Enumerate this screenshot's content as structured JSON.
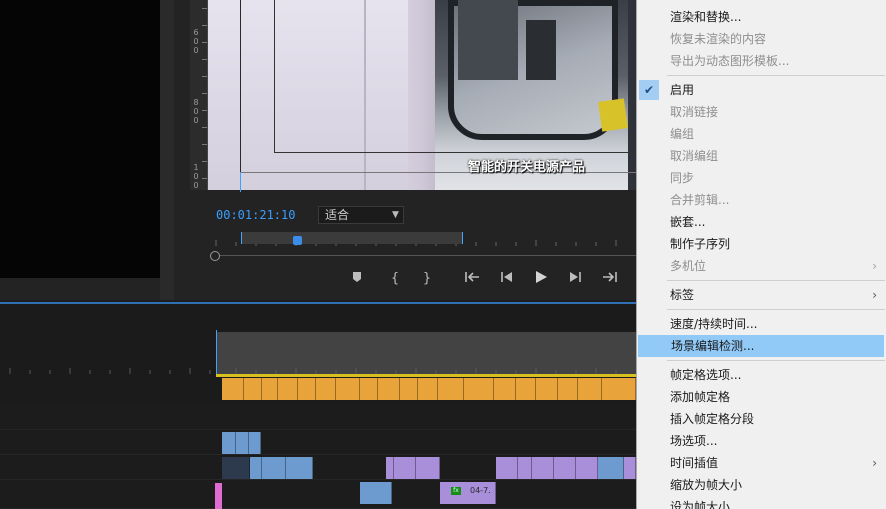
{
  "program_monitor": {
    "timecode": "00:01:21:10",
    "fit_label": "适合",
    "caption": "智能的开关电源产品",
    "ruler_labels": [
      "6",
      "0",
      "0",
      "8",
      "0",
      "0",
      "1",
      "0",
      "0",
      "0"
    ]
  },
  "transport": {
    "marker": "marker-icon",
    "mark_in": "mark-in-icon",
    "mark_out": "mark-out-icon",
    "go_to_in": "go-to-in-icon",
    "step_back": "step-back-icon",
    "play": "play-icon",
    "step_forward": "step-forward-icon",
    "go_to_out": "go-to-out-icon"
  },
  "timeline": {
    "clip_label": "04-7.",
    "fx_badge": "fx"
  },
  "colors": {
    "accent": "#3a9eff",
    "menu_highlight": "#91c9f7",
    "clip_orange": "#e8a33a",
    "clip_blue": "#6e9bcf",
    "clip_purple": "#a98fd9",
    "clip_pink": "#e06bd2"
  },
  "context_menu": {
    "items": [
      {
        "label": "渲染和替换...",
        "enabled": true
      },
      {
        "label": "恢复未渲染的内容",
        "enabled": false
      },
      {
        "label": "导出为动态图形模板...",
        "enabled": false
      },
      {
        "label": "启用",
        "enabled": true,
        "checked": true
      },
      {
        "label": "取消链接",
        "enabled": false
      },
      {
        "label": "编组",
        "enabled": false
      },
      {
        "label": "取消编组",
        "enabled": false
      },
      {
        "label": "同步",
        "enabled": false
      },
      {
        "label": "合并剪辑...",
        "enabled": false
      },
      {
        "label": "嵌套...",
        "enabled": true
      },
      {
        "label": "制作子序列",
        "enabled": true
      },
      {
        "label": "多机位",
        "enabled": false,
        "submenu": true
      },
      {
        "label": "标签",
        "enabled": true,
        "submenu": true
      },
      {
        "label": "速度/持续时间...",
        "enabled": true
      },
      {
        "label": "场景编辑检测...",
        "enabled": true,
        "highlighted": true
      },
      {
        "label": "帧定格选项...",
        "enabled": true
      },
      {
        "label": "添加帧定格",
        "enabled": true
      },
      {
        "label": "插入帧定格分段",
        "enabled": true
      },
      {
        "label": "场选项...",
        "enabled": true
      },
      {
        "label": "时间插值",
        "enabled": true,
        "submenu": true
      },
      {
        "label": "缩放为帧大小",
        "enabled": true
      },
      {
        "label": "设为帧大小",
        "enabled": true
      }
    ]
  }
}
